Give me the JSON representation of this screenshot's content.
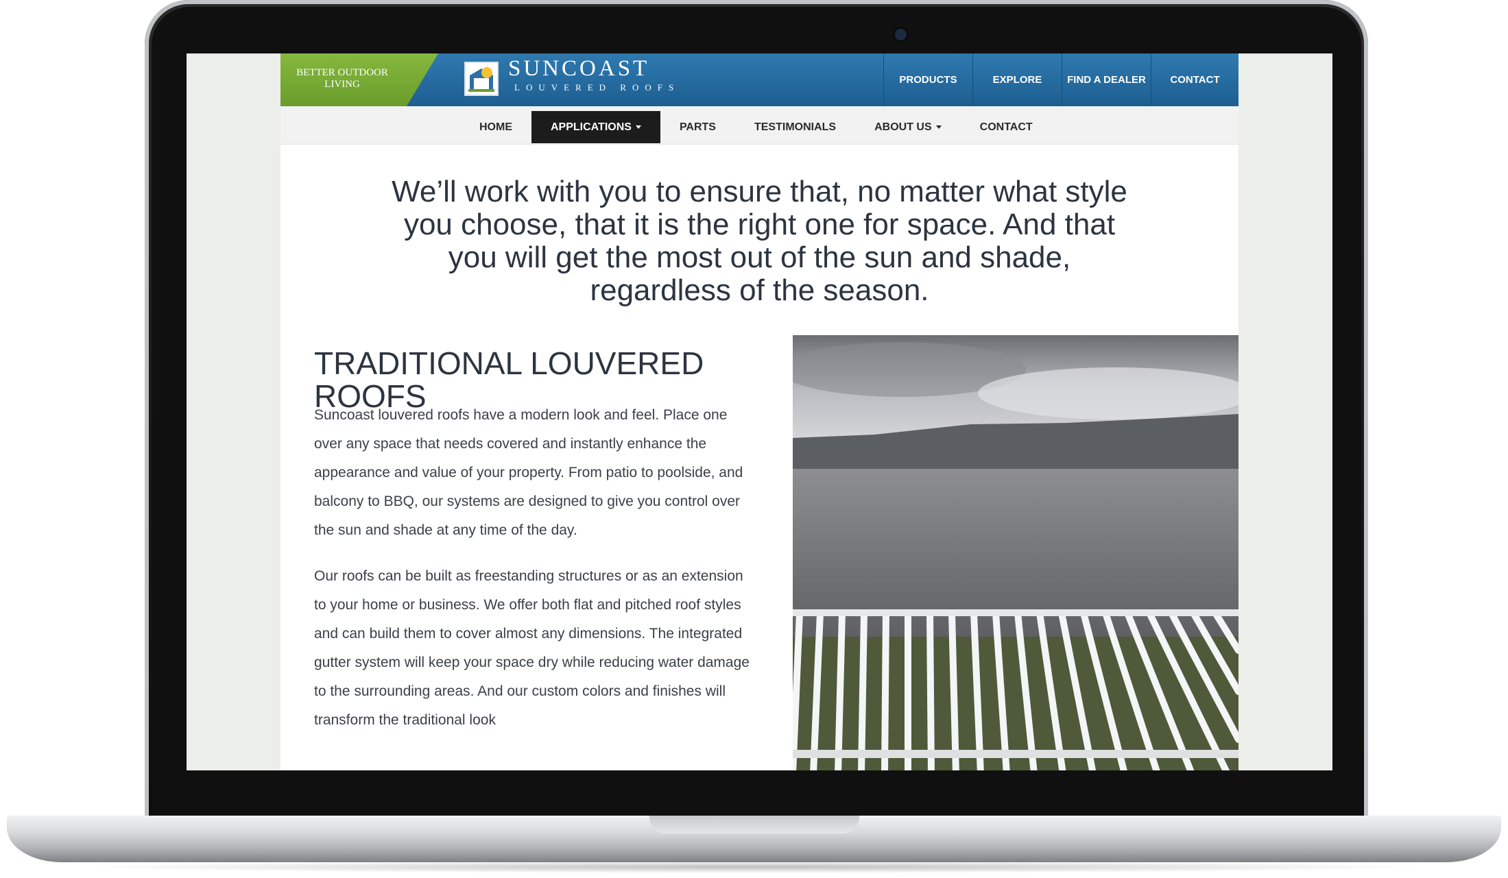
{
  "header": {
    "tagline": "BETTER OUTDOOR LIVING",
    "logo_name": "SUNCOAST",
    "logo_subtitle": "LOUVERED ROOFS",
    "nav": [
      "PRODUCTS",
      "EXPLORE",
      "FIND A DEALER",
      "CONTACT"
    ]
  },
  "subnav": {
    "items": [
      {
        "label": "HOME",
        "active": false,
        "dropdown": false
      },
      {
        "label": "APPLICATIONS",
        "active": true,
        "dropdown": true
      },
      {
        "label": "PARTS",
        "active": false,
        "dropdown": false
      },
      {
        "label": "TESTIMONIALS",
        "active": false,
        "dropdown": false
      },
      {
        "label": "ABOUT US",
        "active": false,
        "dropdown": true
      },
      {
        "label": "CONTACT",
        "active": false,
        "dropdown": false
      }
    ]
  },
  "main": {
    "intro": "We’ll work with you to ensure that, no matter what style you choose, that it is the right one for space. And that you will get the most out of the sun and shade, regardless of the season.",
    "section_title": "TRADITIONAL LOUVERED ROOFS",
    "paragraphs": [
      "Suncoast louvered roofs have a modern look and feel. Place one over any space that needs covered and instantly enhance the appearance and value of your property. From patio to poolside, and balcony to BBQ, our systems are designed to give you control over the sun and shade at any time of the day.",
      "Our roofs can be built as freestanding structures or as an extension to your home or business. We offer both flat and pitched roof styles and can build them to cover almost any dimensions. The integrated gutter system will keep your space dry while reducing water damage to the surrounding areas. And our custom colors and finishes will transform the traditional look"
    ]
  },
  "colors": {
    "brand_blue": "#1d5e91",
    "brand_green": "#76a934",
    "text_dark": "#2c3440",
    "active_nav": "#1c1c1c"
  },
  "icons": [
    "laptop-camera-icon",
    "suncoast-logo-icon",
    "dropdown-caret-icon"
  ]
}
